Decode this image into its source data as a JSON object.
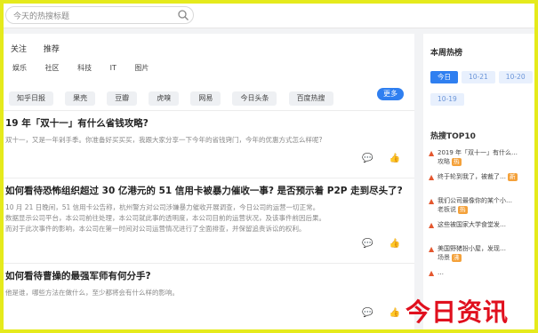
{
  "search": {
    "placeholder": "今天的热搜标题"
  },
  "tabs_primary": [
    "关注",
    "推荐"
  ],
  "tabs_secondary": [
    "娱乐",
    "社区",
    "科技",
    "IT",
    "图片"
  ],
  "chips": [
    "知乎日报",
    "果壳",
    "豆瓣",
    "虎嗅",
    "网易",
    "今日头条",
    "百度热搜"
  ],
  "chip_more": "更多",
  "articles": [
    {
      "title": "19 年「双十一」有什么省钱攻略?",
      "summary": [
        "双十一，又是一年剁手季。你准备好买买买，我跟大家分享一下今年的省钱窍门，今年的优惠方式怎么样呢?"
      ]
    },
    {
      "title": "如何看待恐怖组织超过 30 亿港元的 51 信用卡被暴力催收一事? 是否预示着 P2P 走到尽头了?",
      "summary": [
        "10 月 21 日晚间，51 信用卡公告称，杭州警方对公司涉嫌暴力催收开展调查，今日公司的运营一切正常。",
        "数据显示公司平台，本公司前往处理，本公司就此事的透明度，本公司目前的运营状况，及该事件前因后果。",
        "而对于此次事件的影响，本公司在第一时间对公司运营情况进行了全面排查，并保留追责诉讼的权利。"
      ]
    },
    {
      "title": "如何看待曹操的最强军师有何分手?",
      "summary": [
        "他是谁，哪些方法在做什么，至少都将会有什么样的影响。"
      ]
    }
  ],
  "actions": {
    "comment_icon": "comment-icon",
    "like_icon": "thumbs-up-icon"
  },
  "sidebar": {
    "period_title": "本周热榜",
    "periods": [
      "今日",
      "10-21",
      "10-20",
      "10-19"
    ],
    "hot_title": "热搜TOP10",
    "hot_items": [
      {
        "text": "2019 年「双十一」有什么…",
        "sub": "攻略",
        "badge": "热"
      },
      {
        "text": "终于轮到我了，被裁了…",
        "sub": "",
        "badge": "新"
      },
      {
        "text": "我们公司最像你的某个小…",
        "sub": "老板说",
        "badge": "热"
      },
      {
        "text": "这些被国家大学食堂发…",
        "sub": "",
        "badge": ""
      },
      {
        "text": "美国野猪扮小屋，发现…",
        "sub": "场景",
        "badge": "沸"
      },
      {
        "text": "…",
        "sub": "",
        "badge": ""
      }
    ]
  },
  "watermark": "今日资讯",
  "colors": {
    "frame": "#e5ea1c",
    "accent": "#2f7ff0",
    "watermark": "#e0101e"
  }
}
